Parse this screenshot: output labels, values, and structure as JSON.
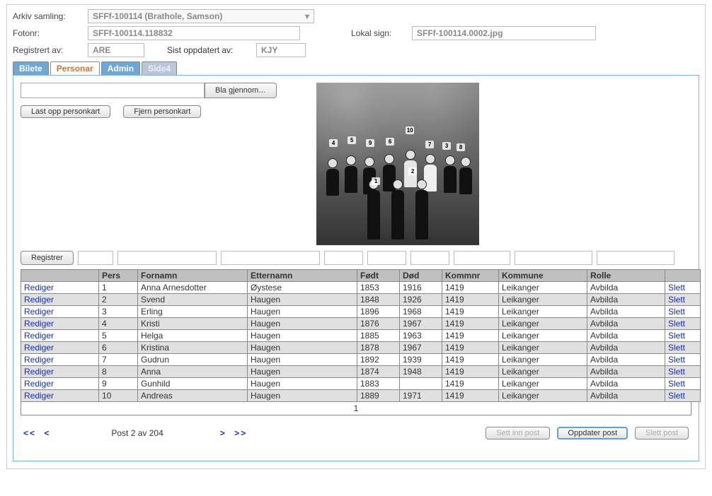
{
  "labels": {
    "arkiv": "Arkiv samling:",
    "fotonr": "Fotonr:",
    "lokal": "Lokal sign:",
    "registrert": "Registrert av:",
    "sist": "Sist oppdatert av:"
  },
  "header": {
    "arkiv_value": "SFFf-100114 (Brathole, Samson)",
    "fotonr_value": "SFFf-100114.118832",
    "lokal_value": "SFFf-100114.0002.jpg",
    "registrert_value": "ARE",
    "sist_value": "KJY"
  },
  "tabs": {
    "t1": "Bilete",
    "t2": "Personar",
    "t3": "Admin",
    "t4": "Side4"
  },
  "buttons": {
    "browse": "Bla gjennom…",
    "upload": "Last opp personkart",
    "remove": "Fjern personkart",
    "registrer": "Registrer",
    "sett_inn": "Sett inn post",
    "oppdater": "Oppdater post",
    "slett": "Slett post"
  },
  "table": {
    "headers": {
      "edit": "",
      "pers": "Pers",
      "fornamn": "Fornamn",
      "etternamn": "Etternamn",
      "fodd": "Født",
      "dod": "Død",
      "kommnr": "Kommnr",
      "kommune": "Kommune",
      "rolle": "Rolle",
      "del": ""
    },
    "edit_label": "Rediger",
    "del_label": "Slett",
    "rows": [
      {
        "pers": "1",
        "fornamn": "Anna Arnesdotter",
        "etternamn": "Øystese",
        "fodd": "1853",
        "dod": "1916",
        "kommnr": "1419",
        "kommune": "Leikanger",
        "rolle": "Avbilda"
      },
      {
        "pers": "2",
        "fornamn": "Svend",
        "etternamn": "Haugen",
        "fodd": "1848",
        "dod": "1926",
        "kommnr": "1419",
        "kommune": "Leikanger",
        "rolle": "Avbilda"
      },
      {
        "pers": "3",
        "fornamn": "Erling",
        "etternamn": "Haugen",
        "fodd": "1896",
        "dod": "1968",
        "kommnr": "1419",
        "kommune": "Leikanger",
        "rolle": "Avbilda"
      },
      {
        "pers": "4",
        "fornamn": "Kristi",
        "etternamn": "Haugen",
        "fodd": "1876",
        "dod": "1967",
        "kommnr": "1419",
        "kommune": "Leikanger",
        "rolle": "Avbilda"
      },
      {
        "pers": "5",
        "fornamn": "Helga",
        "etternamn": "Haugen",
        "fodd": "1885",
        "dod": "1963",
        "kommnr": "1419",
        "kommune": "Leikanger",
        "rolle": "Avbilda"
      },
      {
        "pers": "6",
        "fornamn": "Kristina",
        "etternamn": "Haugen",
        "fodd": "1878",
        "dod": "1967",
        "kommnr": "1419",
        "kommune": "Leikanger",
        "rolle": "Avbilda"
      },
      {
        "pers": "7",
        "fornamn": "Gudrun",
        "etternamn": "Haugen",
        "fodd": "1892",
        "dod": "1939",
        "kommnr": "1419",
        "kommune": "Leikanger",
        "rolle": "Avbilda"
      },
      {
        "pers": "8",
        "fornamn": "Anna",
        "etternamn": "Haugen",
        "fodd": "1874",
        "dod": "1948",
        "kommnr": "1419",
        "kommune": "Leikanger",
        "rolle": "Avbilda"
      },
      {
        "pers": "9",
        "fornamn": "Gunhild",
        "etternamn": "Haugen",
        "fodd": "1883",
        "dod": "",
        "kommnr": "1419",
        "kommune": "Leikanger",
        "rolle": "Avbilda"
      },
      {
        "pers": "10",
        "fornamn": "Andreas",
        "etternamn": "Haugen",
        "fodd": "1889",
        "dod": "1971",
        "kommnr": "1419",
        "kommune": "Leikanger",
        "rolle": "Avbilda"
      }
    ],
    "pager_page": "1"
  },
  "footer": {
    "nav_first": "<<",
    "nav_prev": "<",
    "nav_next": ">",
    "nav_last": ">>",
    "post_text": "Post 2 av 204"
  },
  "photo_markers": [
    "1",
    "2",
    "3",
    "4",
    "5",
    "6",
    "7",
    "8",
    "9",
    "10"
  ]
}
